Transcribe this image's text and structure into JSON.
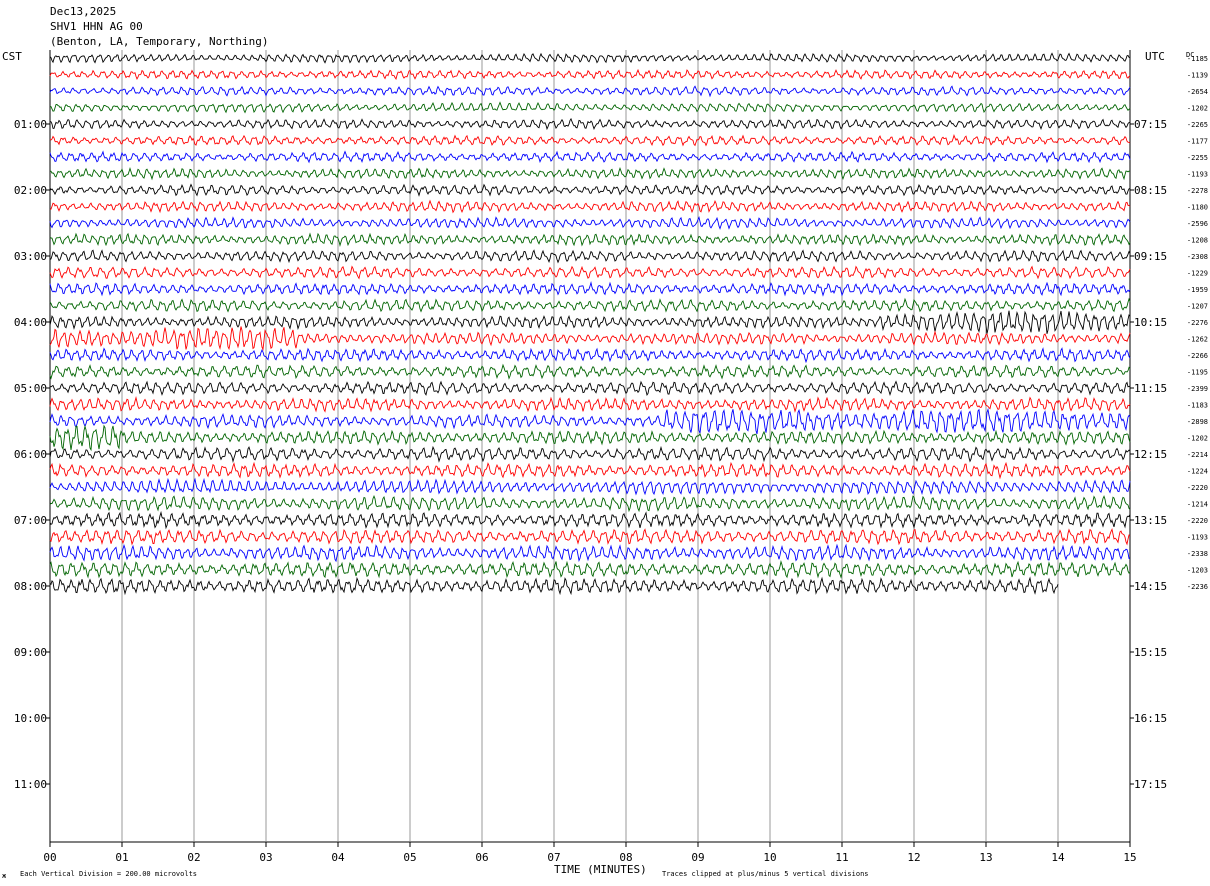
{
  "header": {
    "date": "Dec13,2025",
    "station": "SHV1 HHN AG 00",
    "location": "(Benton, LA, Temporary, Northing)"
  },
  "left_zone": "CST",
  "right_zone": "UTC",
  "dc_header": "DC",
  "footer": {
    "division": "Each Vertical Division =  200.00 microvolts",
    "clip": "Traces clipped at plus/minus 5 vertical divisions",
    "corner": "ж"
  },
  "colors": {
    "trace_cycle": [
      "#000000",
      "#ff0000",
      "#0000ff",
      "#006400"
    ],
    "grid": "#808080"
  },
  "chart_data": {
    "type": "line",
    "xlabel": "TIME (MINUTES)",
    "xlim": [
      0,
      15
    ],
    "x_ticks": [
      "00",
      "01",
      "02",
      "03",
      "04",
      "05",
      "06",
      "07",
      "08",
      "09",
      "10",
      "11",
      "12",
      "13",
      "14",
      "15"
    ],
    "left_hour_labels": [
      "01:00",
      "02:00",
      "03:00",
      "04:00",
      "05:00",
      "06:00",
      "07:00",
      "08:00",
      "09:00",
      "10:00",
      "11:00"
    ],
    "right_hour_labels": [
      "07:15",
      "08:15",
      "09:15",
      "10:15",
      "11:15",
      "12:15",
      "13:15",
      "14:15",
      "15:15",
      "16:15",
      "17:15"
    ],
    "dc_offsets": [
      "-1185",
      "-1139",
      "-2654",
      "-1202",
      "-2265",
      "-1177",
      "-2255",
      "-1193",
      "-2278",
      "-1180",
      "-2596",
      "-1208",
      "-2308",
      "-1229",
      "-1959",
      "-1207",
      "-2276",
      "-1262",
      "-2266",
      "-1195",
      "-2399",
      "-1183",
      "-2898",
      "-1202",
      "-2214",
      "-1224",
      "-2220",
      "-1214",
      "-2220",
      "-1193",
      "-2338",
      "-1203",
      "-2236"
    ],
    "rows_plotted": 33,
    "last_row_end_minute": 14.0,
    "high_noise_segments": [
      {
        "row": 16,
        "from_min": 11.5,
        "to_min": 15.0
      },
      {
        "row": 17,
        "from_min": 0.0,
        "to_min": 3.5
      },
      {
        "row": 22,
        "from_min": 8.5,
        "to_min": 15.0
      },
      {
        "row": 23,
        "from_min": 0.0,
        "to_min": 1.0
      }
    ]
  }
}
